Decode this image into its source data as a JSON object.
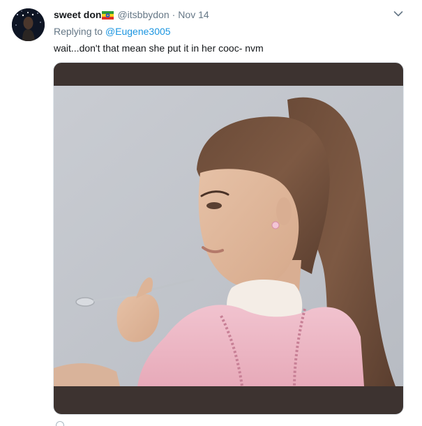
{
  "tweet": {
    "display_name": "sweet don",
    "flag_icon": "ethiopia-flag-emoji",
    "handle": "@itsbbydon",
    "separator": "·",
    "date": "Nov 14",
    "reply_prefix": "Replying to",
    "reply_to": "@Eugene3005",
    "text": "wait...don't that mean she put it in her cooc- nvm",
    "menu_icon": "chevron-down-icon"
  },
  "colors": {
    "secondary_text": "#657786",
    "link": "#1b95e0",
    "media_background": "#3d3330"
  }
}
